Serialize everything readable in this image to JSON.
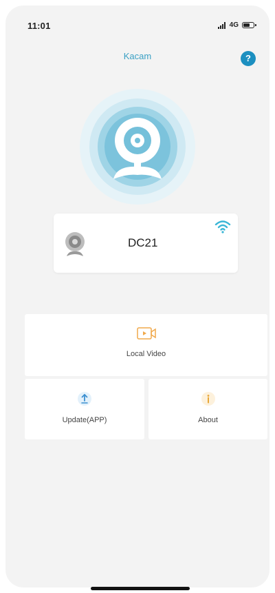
{
  "status_bar": {
    "time": "11:01",
    "network": "4G"
  },
  "header": {
    "title": "Kacam",
    "help_label": "?"
  },
  "device": {
    "name": "DC21"
  },
  "menu": {
    "local_video": "Local Video",
    "update": "Update(APP)",
    "about": "About"
  },
  "colors": {
    "accent": "#3aa0c4",
    "help_button": "#1c8fc0",
    "background": "#f3f3f3"
  },
  "icons": {
    "hero": "webcam-icon",
    "wifi": "wifi-icon",
    "local_video": "video-icon",
    "update": "update-icon",
    "about": "info-icon"
  }
}
